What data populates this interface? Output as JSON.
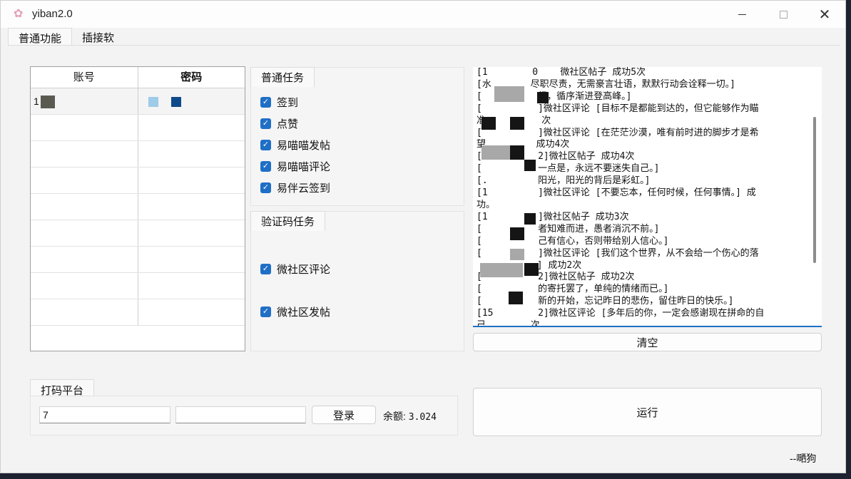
{
  "window": {
    "title": "yiban2.0"
  },
  "tabs": [
    {
      "label": "普通功能"
    },
    {
      "label": "插接软"
    }
  ],
  "accounts": {
    "headers": {
      "account": "账号",
      "password": "密码"
    },
    "rows": [
      {
        "account": "1",
        "password": ""
      }
    ]
  },
  "normal_tasks": {
    "title": "普通任务",
    "items": [
      {
        "label": "签到",
        "checked": true
      },
      {
        "label": "点赞",
        "checked": true
      },
      {
        "label": "易喵喵发帖",
        "checked": true
      },
      {
        "label": "易喵喵评论",
        "checked": true
      },
      {
        "label": "易伴云签到",
        "checked": true
      }
    ]
  },
  "captcha_tasks": {
    "title": "验证码任务",
    "items": [
      {
        "label": "微社区评论",
        "checked": true
      },
      {
        "label": "微社区发帖",
        "checked": true
      }
    ]
  },
  "log": {
    "lines": [
      "[1        0    微社区帖子 成功5次",
      "[水       尽职尽责，无需豪言壮语，默默行动会诠释一切。]",
      "[          经，循序渐进登高峰。]",
      "[          ]微社区评论 [目标不是都能到达的，但它能够作为瞄",
      "准          次",
      "[          ]微社区评论 [在茫茫沙漠，唯有前时进的脚步才是希",
      "望         成功4次",
      "[          2]微社区帖子 成功4次",
      "[          一点是，永远不要迷失自己。]",
      "[.         阳光，阳光的背后是彩虹。]",
      "[1         ]微社区评论 [不要忘本，任何时候，任何事情。] 成",
      "功。",
      "[1         ]微社区帖子 成功3次",
      "[          者知难而进，愚者消沉不前。]",
      "[          己有信心，否则带给别人信心。]",
      "[          ]微社区评论 [我们这个世界，从不会给一个伤心的落",
      "          。] 成功2次",
      "[          2]微社区帖子 成功2次",
      "[          的寄托罢了，单纯的情绪而已。]",
      "[          新的开始，忘记昨日的悲伤，留住昨日的快乐。]",
      "[15        2]微社区评论 [多年后的你，一定会感谢现在拼命的自",
      "己        次"
    ]
  },
  "buttons": {
    "clear": "清空",
    "run": "运行",
    "login": "登录"
  },
  "captcha_platform": {
    "title": "打码平台",
    "username": "7",
    "password": "",
    "balance_label": "余额:",
    "balance_value": "3.024"
  },
  "signature": "--嗮狗"
}
